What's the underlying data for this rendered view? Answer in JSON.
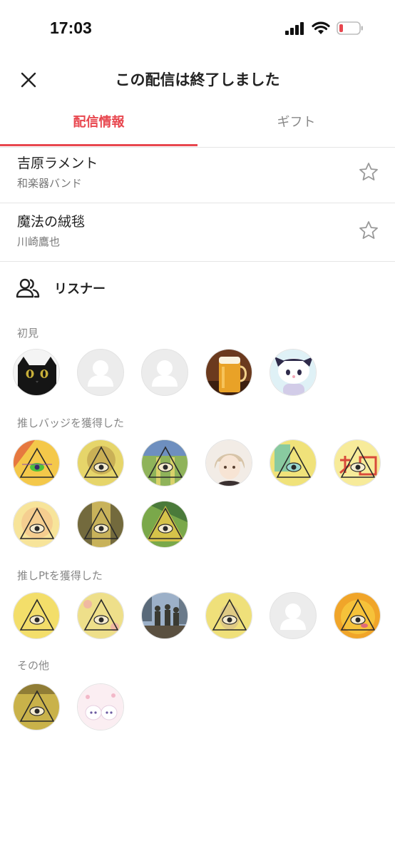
{
  "status": {
    "time": "17:03"
  },
  "header": {
    "title": "この配信は終了しました"
  },
  "tabs": [
    {
      "label": "配信情報"
    },
    {
      "label": "ギフト"
    }
  ],
  "songs": [
    {
      "title": "吉原ラメント",
      "artist": "和楽器バンド"
    },
    {
      "title": "魔法の絨毯",
      "artist": "川崎鷹也"
    }
  ],
  "listeners": {
    "title": "リスナー",
    "sections": [
      {
        "label": "初見"
      },
      {
        "label": "推しバッジを獲得した"
      },
      {
        "label": "推しPtを獲得した"
      },
      {
        "label": "その他"
      }
    ]
  },
  "colors": {
    "accent": "#e8474f",
    "battery": "#e8474f"
  }
}
